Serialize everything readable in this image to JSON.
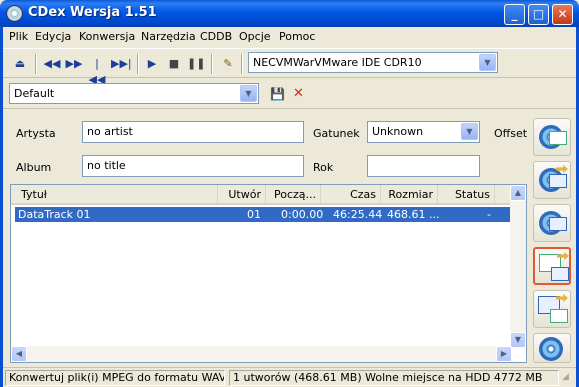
{
  "window": {
    "title": "CDex Wersja 1.51",
    "controls": {
      "minimize": "_",
      "maximize": "□",
      "close": "✕"
    }
  },
  "menu": [
    "Plik",
    "Edycja",
    "Konwersja",
    "Narzędzia",
    "CDDB",
    "Opcje",
    "Pomoc"
  ],
  "toolbar": {
    "buttons": [
      "eject-icon",
      "rewind-icon",
      "forward-icon",
      "previous-track-icon",
      "next-track-icon",
      "play-icon",
      "stop-icon",
      "pause-icon",
      "cd-info-icon"
    ],
    "glyphs": {
      "eject": "⏏",
      "rewind": "◀◀",
      "forward": "▶▶",
      "prev": "|◀◀",
      "next": "▶▶|",
      "play": "▶",
      "stop": "■",
      "pause": "❚❚",
      "cdinfo": "✎"
    },
    "drive": "NECVMWarVMware IDE CDR10"
  },
  "profile": {
    "value": "Default",
    "save_glyph": "💾",
    "delete_glyph": "✕"
  },
  "form": {
    "artist_label": "Artysta",
    "artist_value": "no artist",
    "album_label": "Album",
    "album_value": "no title",
    "genre_label": "Gatunek",
    "genre_value": "Unknown",
    "year_label": "Rok",
    "year_value": "",
    "offset_label": "Offset u"
  },
  "list": {
    "columns": [
      "Tytuł",
      "Utwór",
      "Począ...",
      "Czas",
      "Rozmiar",
      "Status"
    ],
    "rows": [
      {
        "title": "DataTrack 01",
        "track": "01",
        "start": "0:00.00",
        "time": "46:25.44",
        "size": "468.61 ...",
        "status": "-"
      }
    ]
  },
  "sidebar": [
    "extract-tracks-to-wav-icon",
    "extract-tracks-to-compressed-icon",
    "extract-partial-track-icon",
    "convert-wav-to-compressed-icon",
    "convert-compressed-to-wav-icon",
    "record-analog-icon"
  ],
  "status": {
    "hint": "Konwertuj plik(i) MPEG do formatu WAV",
    "summary": "1 utworów (468.61 MB) Wolne miejsce na HDD 4772 MB"
  },
  "colors": {
    "titlebar": "#0058e6",
    "selection": "#316ac5",
    "active_border": "#e0573a"
  }
}
